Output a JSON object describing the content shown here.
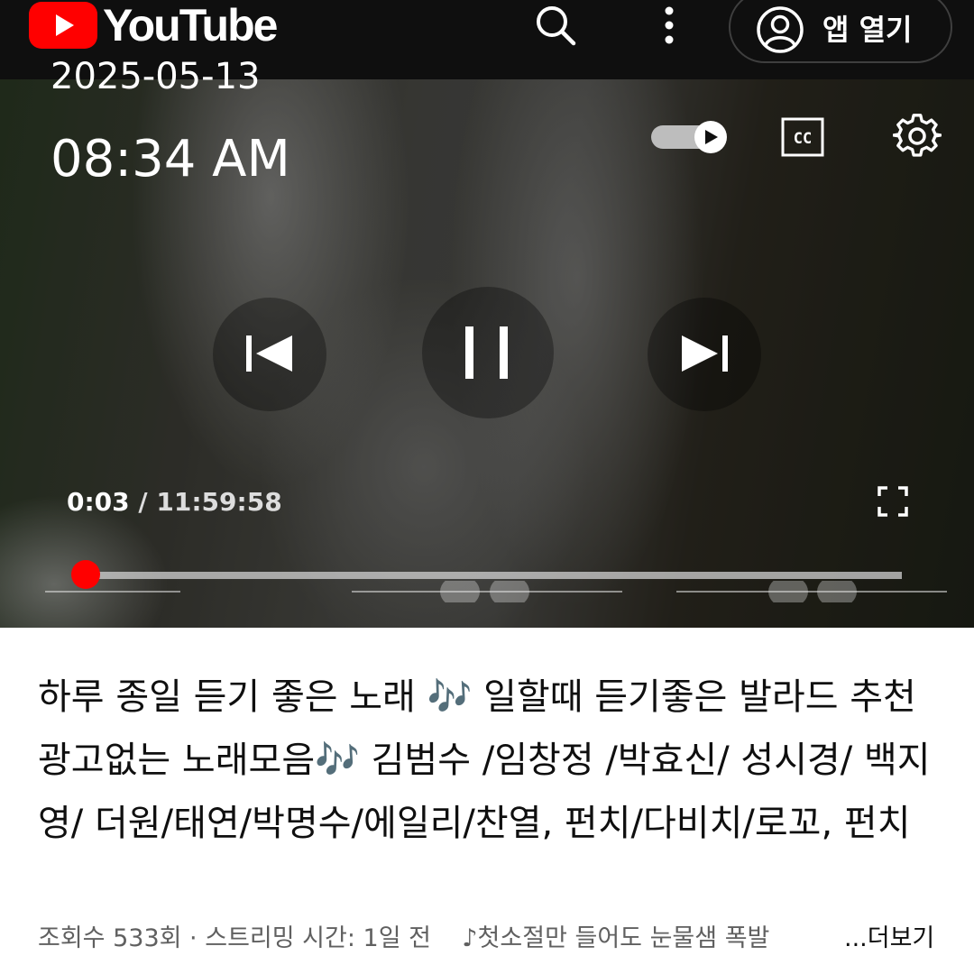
{
  "header": {
    "brand": "YouTube",
    "open_app_label": "앱 열기",
    "icons": [
      "youtube-logo-icon",
      "search-icon",
      "more-vert-icon",
      "account-icon"
    ]
  },
  "overlay": {
    "date": "2025-05-13",
    "time": "08:34 AM"
  },
  "player": {
    "current_time": "0:03",
    "separator": "/",
    "duration": "11:59:58",
    "progress_fraction": 0.0001,
    "accent_color": "#ff0000",
    "autoplay_on": true,
    "icons": [
      "autoplay-toggle-icon",
      "cc-icon",
      "settings-icon",
      "previous-icon",
      "pause-icon",
      "next-icon",
      "fullscreen-icon"
    ]
  },
  "video": {
    "title": "하루 종일 듣기 좋은 노래 🎶 일할때 듣기좋은 발라드 추천 광고없는 노래모음🎶 김범수 /임창정 /박효신/ 성시경/ 백지영/ 더원/태연/박명수/에일리/찬열, 펀치/다비치/로꼬, 펀치",
    "meta": "조회수 533회 · 스트리밍 시간: 1일 전",
    "description_preview": "♪첫소절만 들어도 눈물샘 폭발",
    "more_label": "...더보기"
  }
}
